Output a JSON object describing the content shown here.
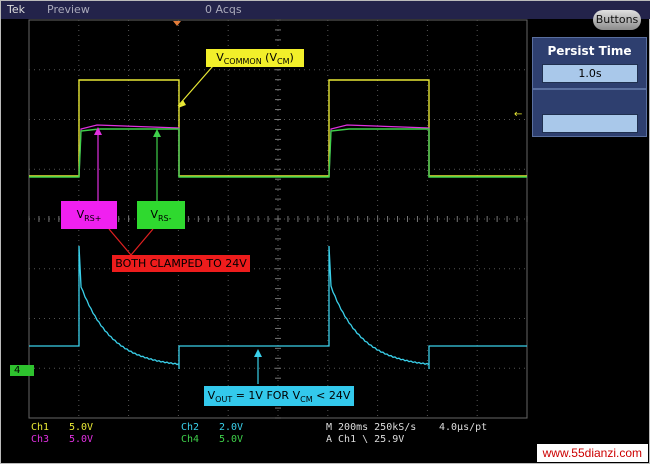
{
  "topbar": {
    "brand": "Tek",
    "mode": "Preview",
    "acqs": "0 Acqs"
  },
  "buttons_label": "Buttons",
  "persist": {
    "title": "Persist Time",
    "value": "1.0s"
  },
  "annotations": {
    "vcommon": "V",
    "vcommon_sub": "COMMON",
    "vcommon_tail": " (V",
    "vcommon_sub2": "CM",
    "vcommon_close": ")",
    "vrs_plus": "V",
    "vrs_plus_sub": "RS+",
    "vrs_minus": "V",
    "vrs_minus_sub": "RS-",
    "clamped": "BOTH CLAMPED TO 24V",
    "vout": "V",
    "vout_sub": "OUT",
    "vout_mid": " = 1V FOR V",
    "vout_sub2": "CM",
    "vout_tail": " < 24V"
  },
  "channels": [
    {
      "name": "Ch1",
      "scale": "5.0V",
      "color": "#e8e835"
    },
    {
      "name": "Ch2",
      "scale": "2.0V",
      "color": "#3ad0ea"
    },
    {
      "name": "Ch3",
      "scale": "5.0V",
      "color": "#e030e0"
    },
    {
      "name": "Ch4",
      "scale": "5.0V",
      "color": "#3ed04a"
    }
  ],
  "timebase": {
    "m": "M 200ms 250kS/s",
    "pt": "4.0µs/pt",
    "trigger": "A  Ch1  \\  25.9V"
  },
  "ch4_marker": "4",
  "watermark": "www.55dianzi.com"
}
